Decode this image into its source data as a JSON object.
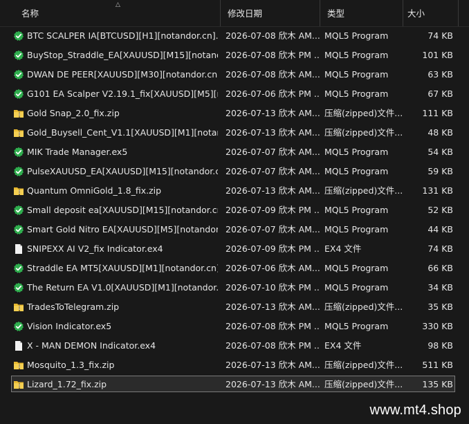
{
  "columns": {
    "name": "名称",
    "date": "修改日期",
    "type": "类型",
    "size": "大小"
  },
  "files": [
    {
      "icon": "mql5",
      "name": "BTC SCALPER IA[BTCUSD][H1][notandor.cn].e...",
      "date": "2026-07-08 欣木 AM...",
      "type": "MQL5 Program",
      "size": "74 KB"
    },
    {
      "icon": "mql5",
      "name": "BuyStop_Straddle_EA[XAUUSD][M15][notand...",
      "date": "2026-07-08 欣木 PM ...",
      "type": "MQL5 Program",
      "size": "101 KB"
    },
    {
      "icon": "mql5",
      "name": "DWAN DE PEER[XAUUSD][M30][notandor.cn]...",
      "date": "2026-07-08 欣木 AM...",
      "type": "MQL5 Program",
      "size": "63 KB"
    },
    {
      "icon": "mql5",
      "name": "G101 EA Scalper V2.19.1_fix[XAUUSD][M5][n...",
      "date": "2026-07-06 欣木 PM ...",
      "type": "MQL5 Program",
      "size": "67 KB"
    },
    {
      "icon": "zip",
      "name": "Gold Snap_2.0_fix.zip",
      "date": "2026-07-13 欣木 AM...",
      "type": "压缩(zipped)文件...",
      "size": "111 KB"
    },
    {
      "icon": "zip",
      "name": "Gold_Buysell_Cent_V1.1[XAUUSD][M1][notan...",
      "date": "2026-07-13 欣木 AM...",
      "type": "压缩(zipped)文件...",
      "size": "48 KB"
    },
    {
      "icon": "mql5",
      "name": "MIK Trade Manager.ex5",
      "date": "2026-07-07 欣木 AM...",
      "type": "MQL5 Program",
      "size": "54 KB"
    },
    {
      "icon": "mql5",
      "name": "PulseXAUUSD_EA[XAUUSD][M15][notandor.c...",
      "date": "2026-07-07 欣木 AM...",
      "type": "MQL5 Program",
      "size": "59 KB"
    },
    {
      "icon": "zip",
      "name": "Quantum OmniGold_1.8_fix.zip",
      "date": "2026-07-13 欣木 AM...",
      "type": "压缩(zipped)文件...",
      "size": "131 KB"
    },
    {
      "icon": "mql5",
      "name": "Small deposit ea[XAUUSD][M15][notandor.cn...",
      "date": "2026-07-09 欣木 PM ...",
      "type": "MQL5 Program",
      "size": "52 KB"
    },
    {
      "icon": "mql5",
      "name": "Smart Gold Nitro EA[XAUUSD][M5][notandor....",
      "date": "2026-07-07 欣木 AM...",
      "type": "MQL5 Program",
      "size": "44 KB"
    },
    {
      "icon": "doc",
      "name": "SNIPEXX AI V2_fix Indicator.ex4",
      "date": "2026-07-09 欣木 PM ...",
      "type": "EX4 文件",
      "size": "74 KB"
    },
    {
      "icon": "mql5",
      "name": "Straddle EA MT5[XAUUSD][M1][notandor.cn]...",
      "date": "2026-07-06 欣木 AM...",
      "type": "MQL5 Program",
      "size": "66 KB"
    },
    {
      "icon": "mql5",
      "name": "The Return EA V1.0[XAUUSD][M1][notandor.c...",
      "date": "2026-07-10 欣木 PM ...",
      "type": "MQL5 Program",
      "size": "34 KB"
    },
    {
      "icon": "zip",
      "name": "TradesToTelegram.zip",
      "date": "2026-07-13 欣木 AM...",
      "type": "压缩(zipped)文件...",
      "size": "35 KB"
    },
    {
      "icon": "mql5",
      "name": "Vision Indicator.ex5",
      "date": "2026-07-08 欣木 PM ...",
      "type": "MQL5 Program",
      "size": "330 KB"
    },
    {
      "icon": "doc",
      "name": "X - MAN DEMON Indicator.ex4",
      "date": "2026-07-08 欣木 PM ...",
      "type": "EX4 文件",
      "size": "98 KB"
    },
    {
      "icon": "zip",
      "name": "Mosquito_1.3_fix.zip",
      "date": "2026-07-13 欣木 AM...",
      "type": "压缩(zipped)文件...",
      "size": "511 KB"
    },
    {
      "icon": "zip",
      "name": "Lizard_1.72_fix.zip",
      "date": "2026-07-13 欣木 AM...",
      "type": "压缩(zipped)文件...",
      "size": "135 KB",
      "selected": true
    }
  ],
  "colors": {
    "mql5_icon": "#2fae4e",
    "zip_icon": "#e8b931",
    "selection_border": "#7a7a7a"
  },
  "watermark": "www.mt4.shop"
}
